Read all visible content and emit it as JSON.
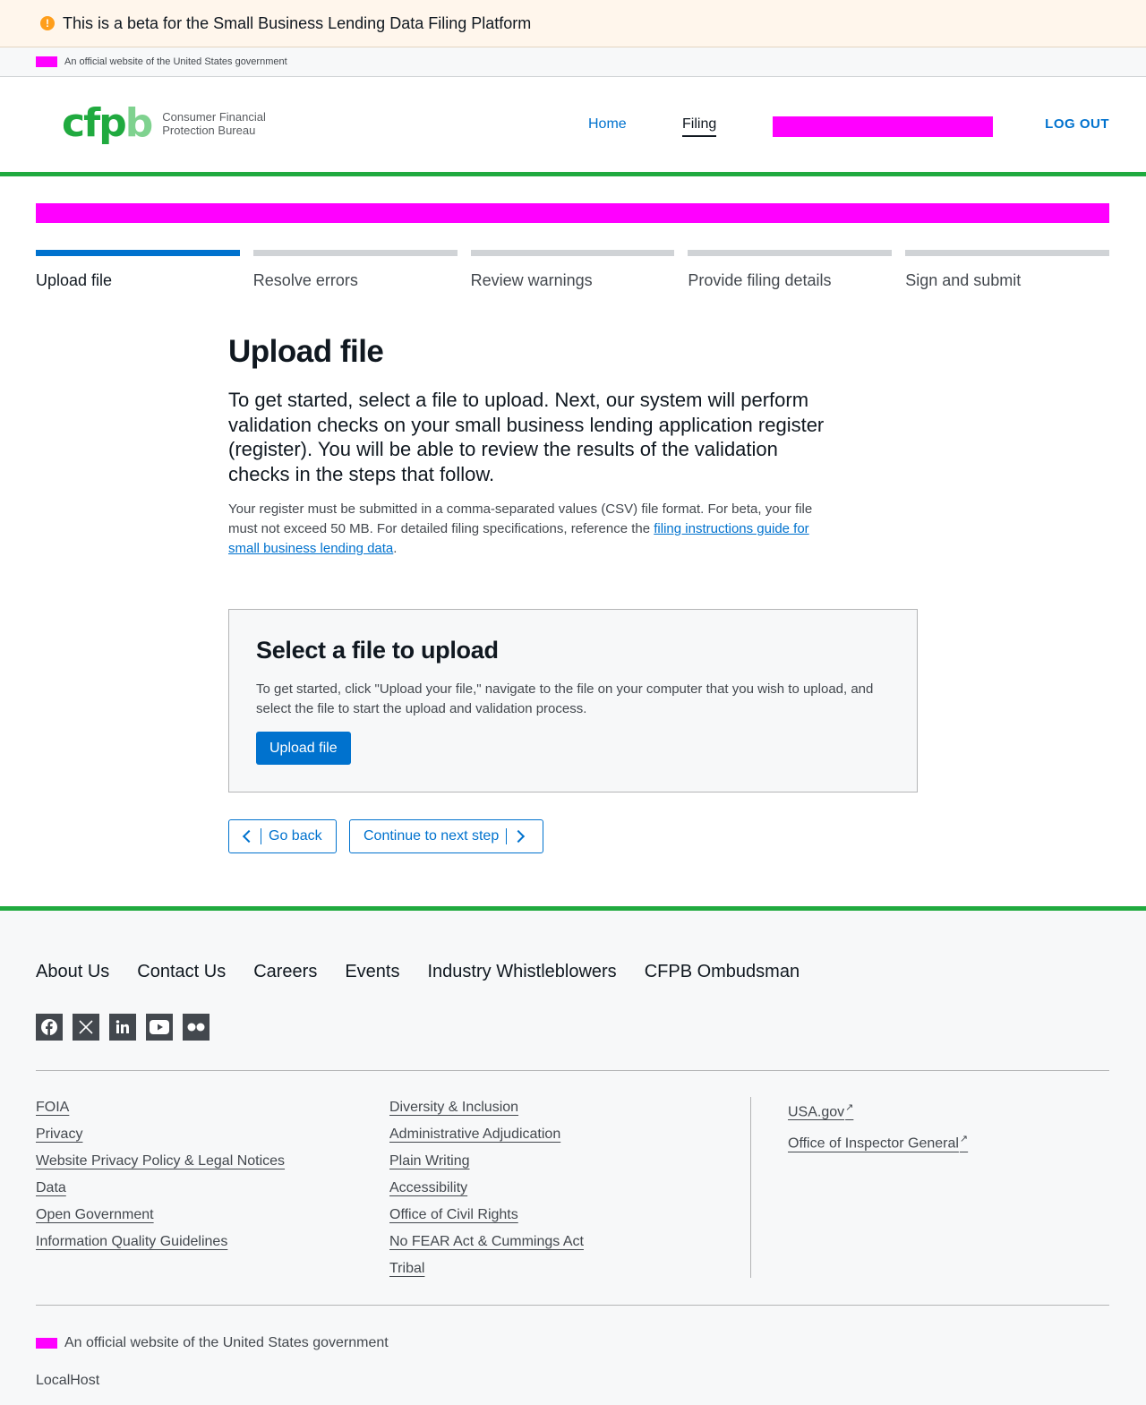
{
  "beta_banner": {
    "icon": "alert-icon",
    "text": "This is a beta for the Small Business Lending Data Filing Platform"
  },
  "gov_banner": {
    "text": "An official website of the United States government"
  },
  "header": {
    "logo_mark": "cfpb",
    "logo_line1": "Consumer Financial",
    "logo_line2": "Protection Bureau",
    "nav": {
      "home": "Home",
      "filing": "Filing",
      "logout": "LOG OUT"
    }
  },
  "colors": {
    "brand_green": "#20aa3f",
    "link_blue": "#0072ce",
    "redaction": "#ff00ff"
  },
  "stepper": {
    "steps": [
      {
        "label": "Upload file",
        "active": true
      },
      {
        "label": "Resolve errors",
        "active": false
      },
      {
        "label": "Review warnings",
        "active": false
      },
      {
        "label": "Provide filing details",
        "active": false
      },
      {
        "label": "Sign and submit",
        "active": false
      }
    ]
  },
  "main": {
    "title": "Upload file",
    "lead": "To get started, select a file to upload. Next, our system will perform validation checks on your small business lending application register (register). You will be able to review the results of the validation checks in the steps that follow.",
    "body_before_link": "Your register must be submitted in a comma-separated values (CSV) file format. For beta, your file must not exceed 50 MB. For detailed filing specifications, reference the ",
    "body_link": "filing instructions guide for small business lending data",
    "body_after_link": "."
  },
  "upload_well": {
    "title": "Select a file to upload",
    "text": "To get started, click \"Upload your file,\" navigate to the file on your computer that you wish to upload, and select the file to start the upload and validation process.",
    "button": "Upload file"
  },
  "step_nav": {
    "back": "Go back",
    "next": "Continue to next step"
  },
  "footer": {
    "nav": [
      "About Us",
      "Contact Us",
      "Careers",
      "Events",
      "Industry Whistleblowers",
      "CFPB Ombudsman"
    ],
    "social": [
      "facebook-icon",
      "x-icon",
      "linkedin-icon",
      "youtube-icon",
      "flickr-icon"
    ],
    "col1": [
      "FOIA",
      "Privacy",
      "Website Privacy Policy & Legal Notices",
      "Data",
      "Open Government",
      "Information Quality Guidelines"
    ],
    "col2": [
      "Diversity & Inclusion",
      "Administrative Adjudication",
      "Plain Writing",
      "Accessibility",
      "Office of Civil Rights",
      "No FEAR Act & Cummings Act",
      "Tribal"
    ],
    "col3": [
      "USA.gov",
      "Office of Inspector General"
    ],
    "official": "An official website of the United States government",
    "host": "LocalHost"
  }
}
